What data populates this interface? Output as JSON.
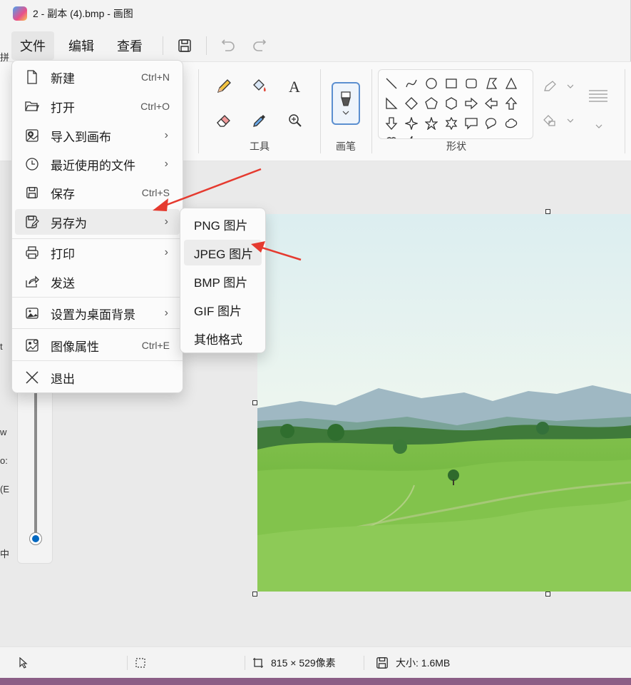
{
  "window": {
    "title": "2 - 副本 (4).bmp - 画图"
  },
  "menubar": {
    "tabs": [
      "文件",
      "编辑",
      "查看"
    ],
    "save_icon": "save-icon",
    "undo_icon": "undo-icon",
    "redo_icon": "redo-icon"
  },
  "ribbon": {
    "tools_label": "工具",
    "brushes_label": "画笔",
    "shapes_label": "形状"
  },
  "file_menu": {
    "items": [
      {
        "label": "新建",
        "shortcut": "Ctrl+N",
        "icon": "new-file-icon"
      },
      {
        "label": "打开",
        "shortcut": "Ctrl+O",
        "icon": "folder-open-icon"
      },
      {
        "label": "导入到画布",
        "shortcut": "",
        "icon": "import-image-icon"
      },
      {
        "label": "最近使用的文件",
        "shortcut": "",
        "icon": "clock-icon"
      },
      {
        "label": "保存",
        "shortcut": "Ctrl+S",
        "icon": "save-icon"
      },
      {
        "label": "另存为",
        "shortcut": "",
        "icon": "save-as-icon"
      },
      {
        "label": "打印",
        "shortcut": "",
        "icon": "printer-icon"
      },
      {
        "label": "发送",
        "shortcut": "",
        "icon": "share-icon"
      },
      {
        "label": "设置为桌面背景",
        "shortcut": "",
        "icon": "desktop-background-icon"
      },
      {
        "label": "图像属性",
        "shortcut": "Ctrl+E",
        "icon": "image-properties-icon"
      },
      {
        "label": "退出",
        "shortcut": "",
        "icon": "close-icon"
      }
    ]
  },
  "saveas_menu": {
    "items": [
      "PNG 图片",
      "JPEG 图片",
      "BMP 图片",
      "GIF 图片",
      "其他格式"
    ]
  },
  "edge_texts": [
    "拼",
    "t",
    "w",
    "o:",
    "(E",
    "中"
  ],
  "statusbar": {
    "dimensions": "815 × 529像素",
    "size": "大小: 1.6MB"
  },
  "colors": {
    "accent": "#0067c0",
    "annotation_arrow": "#e53a2f"
  }
}
